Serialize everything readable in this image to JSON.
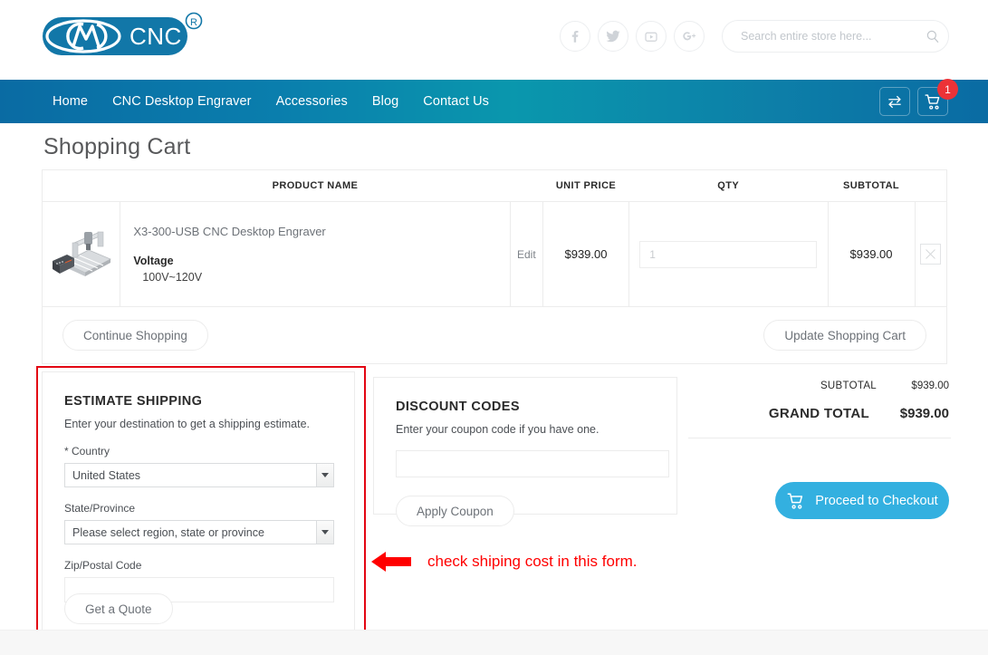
{
  "header": {
    "logo_main": "CNC",
    "logo_mark": "CMD",
    "logo_reg": "®",
    "social": [
      {
        "name": "facebook-icon",
        "label": "Facebook"
      },
      {
        "name": "twitter-icon",
        "label": "Twitter"
      },
      {
        "name": "youtube-icon",
        "label": "YouTube"
      },
      {
        "name": "googleplus-icon",
        "label": "Google Plus"
      }
    ],
    "search": {
      "placeholder": "Search entire store here...",
      "value": "",
      "icon": "search-icon"
    }
  },
  "nav": {
    "items": [
      {
        "label": "Home"
      },
      {
        "label": "CNC Desktop Engraver"
      },
      {
        "label": "Accessories"
      },
      {
        "label": "Blog"
      },
      {
        "label": "Contact Us"
      }
    ],
    "compare_icon": "compare-arrows-icon",
    "cart_icon": "shopping-cart-icon",
    "cart_count": "1",
    "badge_color": "#ec3237",
    "gradient_from": "#0a6ba3",
    "gradient_mid": "#0a97ad",
    "gradient_to": "#0a6ba3"
  },
  "page": {
    "title": "Shopping Cart"
  },
  "cart": {
    "columns": {
      "thumb": "",
      "product_name": "PRODUCT NAME",
      "edit": "",
      "unit_price": "UNIT PRICE",
      "qty": "QTY",
      "subtotal": "SUBTOTAL",
      "remove": ""
    },
    "items": [
      {
        "image_alt": "X3-300-USB CNC Desktop Engraver machine",
        "name": "X3-300-USB CNC Desktop Engraver",
        "option_label": "Voltage",
        "option_value": "100V~120V",
        "edit_label": "Edit",
        "unit_price": "$939.00",
        "qty_value": "1",
        "qty_placeholder": "1",
        "subtotal": "$939.00",
        "remove_icon": "close-icon"
      }
    ],
    "continue_label": "Continue Shopping",
    "update_label": "Update Shopping Cart"
  },
  "estimate_shipping": {
    "heading": "ESTIMATE SHIPPING",
    "subtitle": "Enter your destination to get a shipping estimate.",
    "country_label": "* Country",
    "country_value": "United States",
    "country_options": [
      "United States"
    ],
    "state_label": "State/Province",
    "state_value": "Please select region, state or province",
    "state_options": [
      "Please select region, state or province"
    ],
    "zip_label": "Zip/Postal Code",
    "zip_value": "",
    "quote_button": "Get a Quote"
  },
  "discount_codes": {
    "heading": "DISCOUNT CODES",
    "subtitle": "Enter your coupon code if you have one.",
    "coupon_value": "",
    "coupon_placeholder": "",
    "apply_button": "Apply Coupon"
  },
  "totals": {
    "subtotal_label": "SUBTOTAL",
    "subtotal_value": "$939.00",
    "grand_total_label": "GRAND TOTAL",
    "grand_total_value": "$939.00",
    "checkout_label": "Proceed to Checkout",
    "checkout_icon": "shopping-cart-icon",
    "checkout_color": "#33b0e0"
  },
  "annotation": {
    "text": "check shiping cost in this form.",
    "color": "#ff0000",
    "arrow_icon": "left-arrow-icon",
    "highlight_color": "#e30613"
  }
}
